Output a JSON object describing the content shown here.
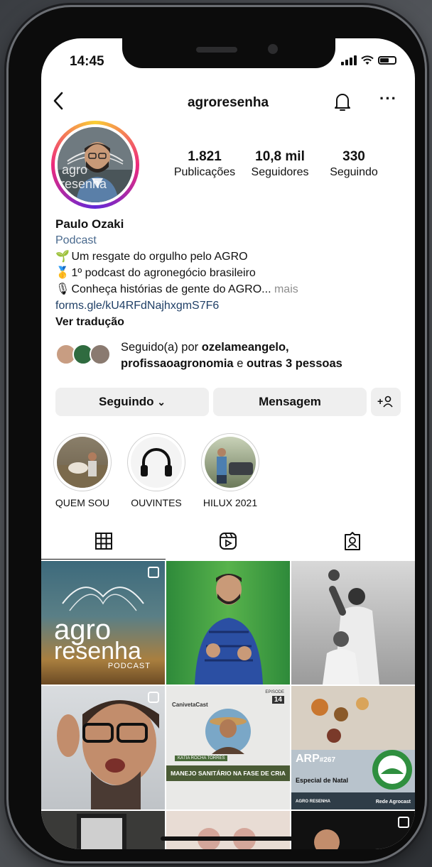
{
  "status_bar": {
    "time": "14:45"
  },
  "header": {
    "username": "agroresenha",
    "more_label": "···"
  },
  "profile": {
    "stats": [
      {
        "value": "1.821",
        "label": "Publicações"
      },
      {
        "value": "10,8 mil",
        "label": "Seguidores"
      },
      {
        "value": "330",
        "label": "Seguindo"
      }
    ],
    "name": "Paulo Ozaki",
    "category": "Podcast",
    "bio_lines": [
      {
        "emoji": "🌱",
        "text": "Um resgate do orgulho pelo AGRO"
      },
      {
        "emoji": "🥇",
        "text": "1º podcast do agronegócio brasileiro"
      },
      {
        "emoji": "🎙",
        "text": "Conheça histórias de gente do AGRO..."
      }
    ],
    "bio_more": "mais",
    "link": "forms.gle/kU4RFdNajhxgmS7F6",
    "translate": "Ver tradução"
  },
  "followed_by": {
    "prefix": "Seguido(a) por",
    "user1": "ozelameangelo,",
    "user2": "profissaoagronomia",
    "and": "e",
    "others": "outras 3 pessoas"
  },
  "actions": {
    "following": "Seguindo",
    "following_caret": "⌄",
    "message": "Mensagem",
    "add_person": "+"
  },
  "highlights": [
    {
      "label": "QUEM SOU"
    },
    {
      "label": "OUVINTES"
    },
    {
      "label": "HILUX 2021"
    }
  ],
  "grid": {
    "post1": {
      "line1": "agro",
      "line2": "resenha",
      "line3": "PODCAST"
    },
    "post5": {
      "brand": "CanivetaCast",
      "episode": "EPISODE",
      "ep_num": "14",
      "banner": "MANEJO SANITÁRIO NA FASE DE CRIA",
      "tag": "KÁTIA ROCHA TORRES"
    },
    "post6": {
      "code": "ARP",
      "num": "#267",
      "subtitle": "Especial de Natal",
      "brand": "AGRO RESENHA",
      "guest": "Rede Agrocast"
    }
  },
  "colors": {
    "link": "#1f3f66",
    "category": "#4a6a8e",
    "button_bg": "#efefef"
  }
}
